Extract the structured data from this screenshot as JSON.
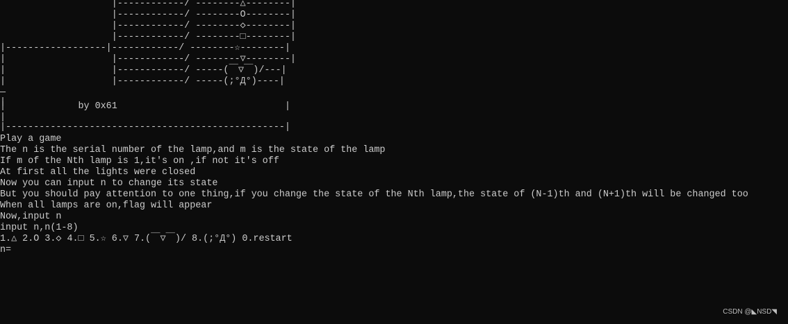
{
  "console": {
    "lines": [
      "                    |------------/ --------△--------|",
      "                    |------------/ --------O--------|",
      "                    |------------/ --------◇--------|",
      "                    |------------/ --------□--------|",
      "|------------------|------------/ --------☆--------|",
      "|                   |------------/ --------▽--------|",
      "|                   |------------/ -----(￣▽￣)/---|",
      "|                   |------------/ -----(;°Д°)----|",
      "—",
      "|",
      "|             by 0x61                              |",
      "|",
      "|--------------------------------------------------|",
      "Play a game",
      "The n is the serial number of the lamp,and m is the state of the lamp",
      "If m of the Nth lamp is 1,it's on ,if not it's off",
      "At first all the lights were closed",
      "Now you can input n to change its state",
      "But you should pay attention to one thing,if you change the state of the Nth lamp,the state of (N-1)th and (N+1)th will be changed too",
      "When all lamps are on,flag will appear",
      "Now,input n",
      "input n,n(1-8)",
      "1.△ 2.O 3.◇ 4.□ 5.☆ 6.▽ 7.(￣▽￣)/ 8.(;°Д°) 0.restart",
      "n="
    ]
  },
  "watermark": {
    "text": "CSDN @◣NSD◥"
  }
}
